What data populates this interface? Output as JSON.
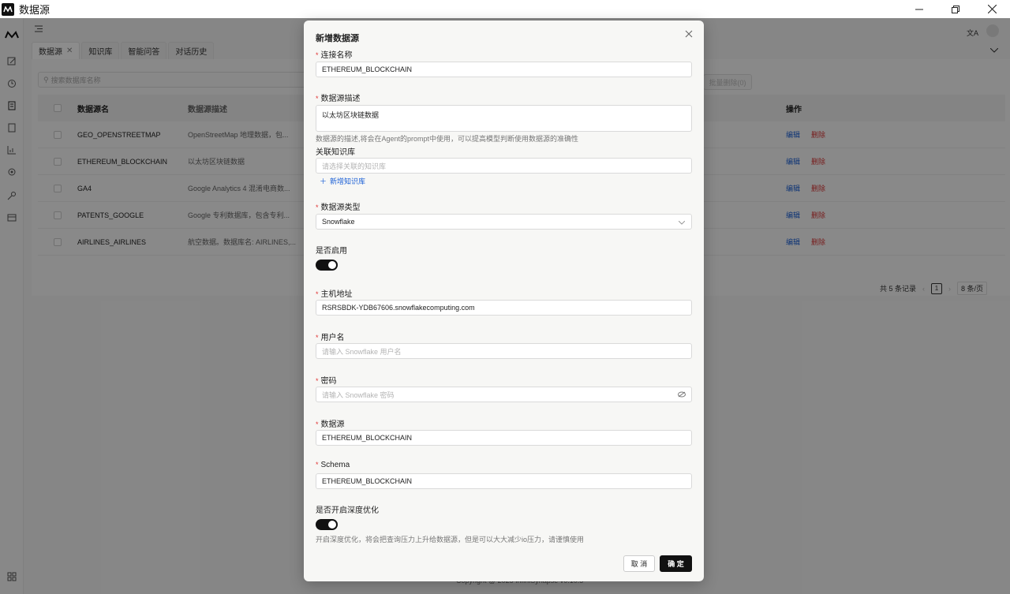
{
  "window": {
    "title": "数据源"
  },
  "tabs": [
    {
      "label": "数据源"
    },
    {
      "label": "知识库"
    },
    {
      "label": "智能问答"
    },
    {
      "label": "对话历史"
    }
  ],
  "list": {
    "search_placeholder": "搜索数据库名称",
    "batch_delete": "批量删除(0)",
    "columns": {
      "name": "数据源名",
      "desc": "数据源描述",
      "ops": "操作"
    },
    "rows": [
      {
        "name": "GEO_OPENSTREETMAP",
        "desc": "OpenStreetMap 地理数据，包..."
      },
      {
        "name": "ETHEREUM_BLOCKCHAIN",
        "desc": "以太坊区块链数据"
      },
      {
        "name": "GA4",
        "desc": "Google Analytics 4 混淆电商数..."
      },
      {
        "name": "PATENTS_GOOGLE",
        "desc": "Google 专利数据库，包含专利..."
      },
      {
        "name": "AIRLINES_AIRLINES",
        "desc": "航空数据。数据库名: AIRLINES,..."
      }
    ],
    "edit_label": "编辑",
    "delete_label": "删除",
    "pager": {
      "total": "共 5 条记录",
      "page": "1",
      "page_size": "8 条/页"
    }
  },
  "copyright": "Copyright @ 2025 InfiniSynapse v0.10.5",
  "modal": {
    "title": "新增数据源",
    "conn_name": {
      "label": "连接名称",
      "value": "ETHEREUM_BLOCKCHAIN"
    },
    "desc": {
      "label": "数据源描述",
      "value": "以太坊区块链数据",
      "help": "数据源的描述,将会在Agent的prompt中使用，可以提高模型判断使用数据源的准确性"
    },
    "kb": {
      "label": "关联知识库",
      "placeholder": "请选择关联的知识库",
      "add_link": "新增知识库"
    },
    "type": {
      "label": "数据源类型",
      "value": "Snowflake"
    },
    "enabled": {
      "label": "是否启用",
      "on": true
    },
    "host": {
      "label": "主机地址",
      "value": "RSRSBDK-YDB67606.snowflakecomputing.com"
    },
    "username": {
      "label": "用户名",
      "placeholder": "请输入 Snowflake 用户名"
    },
    "password": {
      "label": "密码",
      "placeholder": "请输入 Snowflake 密码"
    },
    "database": {
      "label": "数据源",
      "value": "ETHEREUM_BLOCKCHAIN"
    },
    "schema": {
      "label": "Schema",
      "value": "ETHEREUM_BLOCKCHAIN"
    },
    "deep_opt": {
      "label": "是否开启深度优化",
      "on": true,
      "help": "开启深度优化，将会把查询压力上升给数据源，但是可以大大减少io压力，请谨慎使用"
    },
    "cancel": "取 消",
    "ok": "确 定"
  },
  "colors": {
    "accent": "#111111",
    "link": "#1a5fd6",
    "danger": "#d93535"
  }
}
